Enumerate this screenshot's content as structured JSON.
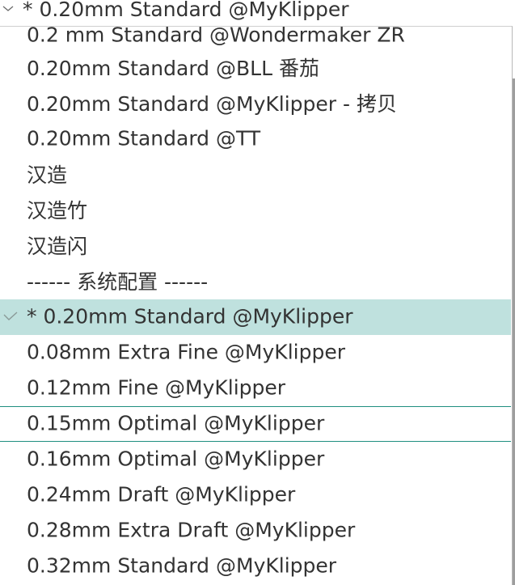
{
  "combo": {
    "current_value": "* 0.20mm Standard @MyKlipper",
    "chevron_icon": "chevron-down-icon"
  },
  "list": {
    "items": [
      {
        "label": "0.2 mm  Standard @Wondermaker ZR"
      },
      {
        "label": "0.20mm Standard @BLL 番茄"
      },
      {
        "label": "0.20mm Standard @MyKlipper - 拷贝"
      },
      {
        "label": "0.20mm Standard @TT"
      },
      {
        "label": "汉造"
      },
      {
        "label": "汉造竹"
      },
      {
        "label": "汉造闪"
      },
      {
        "label": "------ 系统配置 ------"
      },
      {
        "label": "* 0.20mm Standard @MyKlipper"
      },
      {
        "label": "0.08mm Extra Fine @MyKlipper"
      },
      {
        "label": "0.12mm Fine @MyKlipper"
      },
      {
        "label": "0.15mm Optimal @MyKlipper"
      },
      {
        "label": "0.16mm Optimal @MyKlipper"
      },
      {
        "label": "0.24mm Draft @MyKlipper"
      },
      {
        "label": "0.28mm Extra Draft @MyKlipper"
      },
      {
        "label": "0.32mm Standard @MyKlipper"
      }
    ],
    "check_icon": "checkmark-icon"
  },
  "colors": {
    "selected_bg": "#bfe1de",
    "focus_border": "#1f8f80",
    "text": "#333333"
  }
}
